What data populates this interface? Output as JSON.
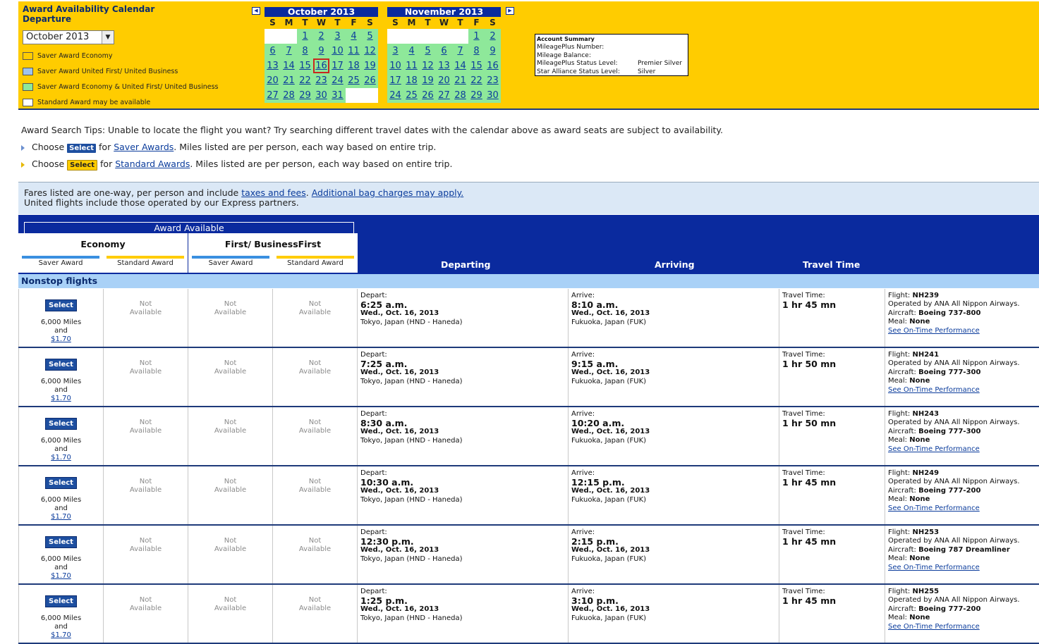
{
  "calendar": {
    "title_line1": "Award Availability Calendar",
    "title_line2": "Departure",
    "month_select": "October 2013",
    "legend": [
      {
        "label": "Saver Award Economy",
        "color": "#ffcc00"
      },
      {
        "label": "Saver Award United First/ United Business",
        "color": "#9ec3ec"
      },
      {
        "label": "Saver Award Economy & United First/ United Business",
        "color": "#8ee89a"
      },
      {
        "label": "Standard Award may be available",
        "color": "#ffffff"
      }
    ],
    "dow": [
      "S",
      "M",
      "T",
      "W",
      "T",
      "F",
      "S"
    ],
    "months": [
      {
        "name": "October 2013",
        "weeks": [
          [
            "",
            "",
            "1",
            "2",
            "3",
            "4",
            "5"
          ],
          [
            "6",
            "7",
            "8",
            "9",
            "10",
            "11",
            "12"
          ],
          [
            "13",
            "14",
            "15",
            "16",
            "17",
            "18",
            "19"
          ],
          [
            "20",
            "21",
            "22",
            "23",
            "24",
            "25",
            "26"
          ],
          [
            "27",
            "28",
            "29",
            "30",
            "31",
            "",
            ""
          ]
        ],
        "selected": "16"
      },
      {
        "name": "November 2013",
        "weeks": [
          [
            "",
            "",
            "",
            "",
            "",
            "1",
            "2"
          ],
          [
            "3",
            "4",
            "5",
            "6",
            "7",
            "8",
            "9"
          ],
          [
            "10",
            "11",
            "12",
            "13",
            "14",
            "15",
            "16"
          ],
          [
            "17",
            "18",
            "19",
            "20",
            "21",
            "22",
            "23"
          ],
          [
            "24",
            "25",
            "26",
            "27",
            "28",
            "29",
            "30"
          ]
        ],
        "selected": ""
      }
    ]
  },
  "account": {
    "title": "Account Summary",
    "rows": [
      {
        "label": "MileagePlus Number:",
        "value": ""
      },
      {
        "label": "Mileage Balance:",
        "value": ""
      },
      {
        "label": "MileagePlus Status Level:",
        "value": "Premier Silver"
      },
      {
        "label": "Star Alliance Status Level:",
        "value": "Silver"
      }
    ]
  },
  "tips": {
    "main": "Award Search Tips: Unable to locate the flight you want? Try searching different travel dates with the calendar above as award seats are subject to availability.",
    "choose": "Choose",
    "select": "Select",
    "for": "for",
    "saver_link": "Saver Awards",
    "standard_link": "Standard Awards",
    "suffix": ". Miles listed are per person, each way based on entire trip."
  },
  "fare_note": {
    "prefix": "Fares listed are one-way, per person and include ",
    "taxes_link": "taxes and fees",
    "mid": ". ",
    "bag_link": "Additional bag charges may apply.",
    "line2": "United flights include those operated by our Express partners."
  },
  "table_header": {
    "award_available": "Award Available",
    "economy": "Economy",
    "first": "First/ BusinessFirst",
    "saver": "Saver Award",
    "standard": "Standard Award",
    "departing": "Departing",
    "arriving": "Arriving",
    "travel_time": "Travel Time"
  },
  "nonstop_label": "Nonstop flights",
  "labels": {
    "select": "Select",
    "not": "Not",
    "available": "Available",
    "depart": "Depart:",
    "arrive": "Arrive:",
    "travel_time": "Travel Time:",
    "flight": "Flight:",
    "aircraft": "Aircraft:",
    "meal": "Meal:",
    "and": "and",
    "on_time": "See On-Time Performance"
  },
  "flights": [
    {
      "miles": "6,000 Miles",
      "fee": "$1.70",
      "dep_time": "6:25 a.m.",
      "date": "Wed., Oct. 16, 2013",
      "origin": "Tokyo, Japan (HND - Haneda)",
      "arr_time": "8:10 a.m.",
      "destination": "Fukuoka, Japan (FUK)",
      "duration": "1 hr 45 mn",
      "flight": "NH239",
      "operated": "Operated by ANA All Nippon Airways.",
      "aircraft": "Boeing 737-800",
      "meal": "None"
    },
    {
      "miles": "6,000 Miles",
      "fee": "$1.70",
      "dep_time": "7:25 a.m.",
      "date": "Wed., Oct. 16, 2013",
      "origin": "Tokyo, Japan (HND - Haneda)",
      "arr_time": "9:15 a.m.",
      "destination": "Fukuoka, Japan (FUK)",
      "duration": "1 hr 50 mn",
      "flight": "NH241",
      "operated": "Operated by ANA All Nippon Airways.",
      "aircraft": "Boeing 777-300",
      "meal": "None"
    },
    {
      "miles": "6,000 Miles",
      "fee": "$1.70",
      "dep_time": "8:30 a.m.",
      "date": "Wed., Oct. 16, 2013",
      "origin": "Tokyo, Japan (HND - Haneda)",
      "arr_time": "10:20 a.m.",
      "destination": "Fukuoka, Japan (FUK)",
      "duration": "1 hr 50 mn",
      "flight": "NH243",
      "operated": "Operated by ANA All Nippon Airways.",
      "aircraft": "Boeing 777-300",
      "meal": "None"
    },
    {
      "miles": "6,000 Miles",
      "fee": "$1.70",
      "dep_time": "10:30 a.m.",
      "date": "Wed., Oct. 16, 2013",
      "origin": "Tokyo, Japan (HND - Haneda)",
      "arr_time": "12:15 p.m.",
      "destination": "Fukuoka, Japan (FUK)",
      "duration": "1 hr 45 mn",
      "flight": "NH249",
      "operated": "Operated by ANA All Nippon Airways.",
      "aircraft": "Boeing 777-200",
      "meal": "None"
    },
    {
      "miles": "6,000 Miles",
      "fee": "$1.70",
      "dep_time": "12:30 p.m.",
      "date": "Wed., Oct. 16, 2013",
      "origin": "Tokyo, Japan (HND - Haneda)",
      "arr_time": "2:15 p.m.",
      "destination": "Fukuoka, Japan (FUK)",
      "duration": "1 hr 45 mn",
      "flight": "NH253",
      "operated": "Operated by ANA All Nippon Airways.",
      "aircraft": "Boeing 787 Dreamliner",
      "meal": "None"
    },
    {
      "miles": "6,000 Miles",
      "fee": "$1.70",
      "dep_time": "1:25 p.m.",
      "date": "Wed., Oct. 16, 2013",
      "origin": "Tokyo, Japan (HND - Haneda)",
      "arr_time": "3:10 p.m.",
      "destination": "Fukuoka, Japan (FUK)",
      "duration": "1 hr 45 mn",
      "flight": "NH255",
      "operated": "Operated by ANA All Nippon Airways.",
      "aircraft": "Boeing 777-200",
      "meal": "None"
    }
  ],
  "colors": {
    "banner": "#ffcc00",
    "navy": "#0a2a9e",
    "calendar_avail": "#8ee89a",
    "nonstop_bar": "#a9d1f7"
  }
}
